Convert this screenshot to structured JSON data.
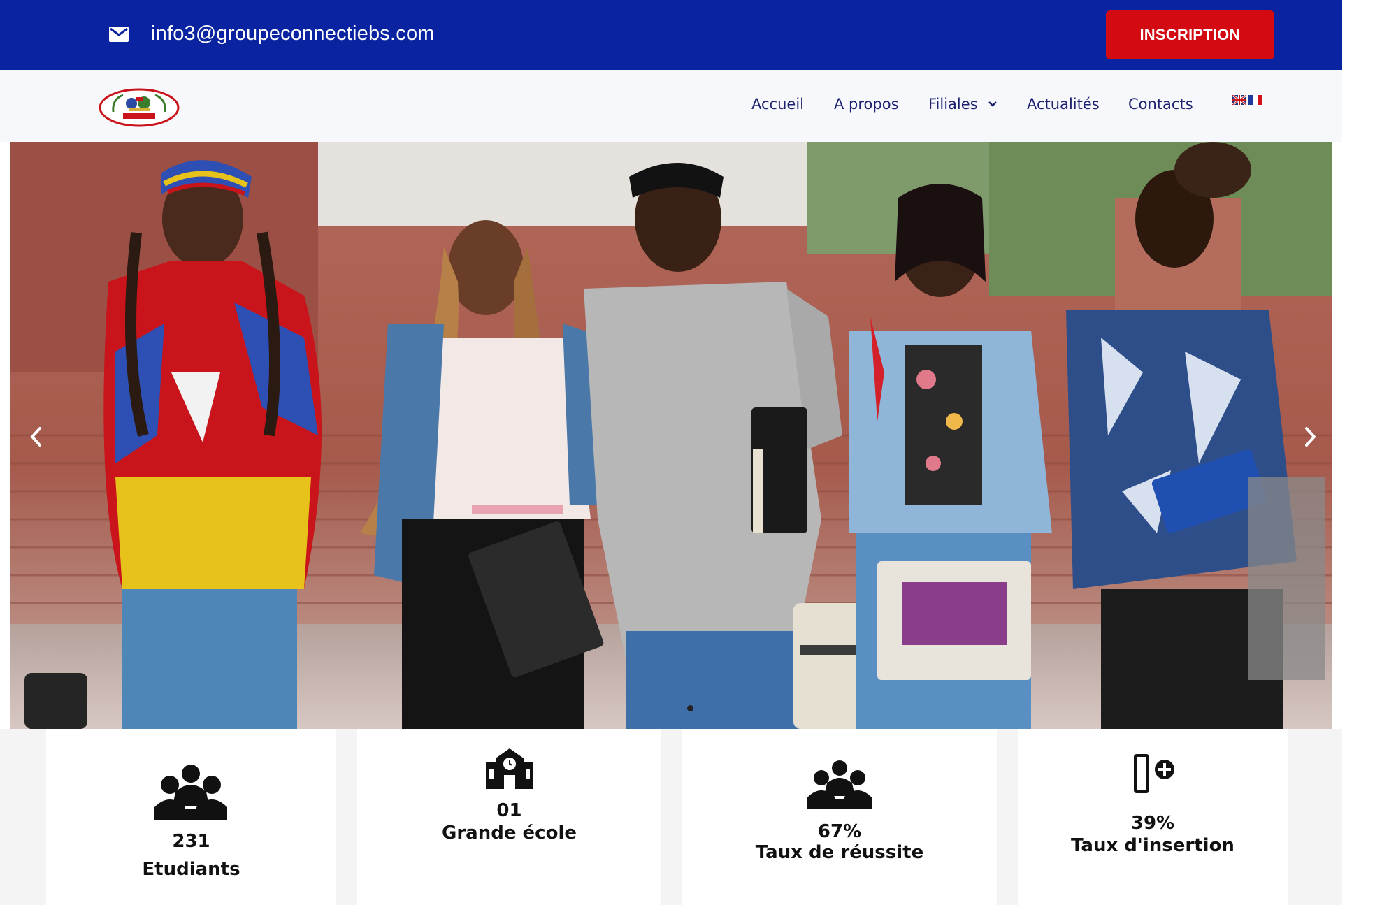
{
  "topbar": {
    "email": "info3@groupeconnectiebs.com",
    "email_icon": "mail-icon",
    "cta_label": "INSCRIPTION",
    "background": "#0a23a0",
    "cta_color": "#d40a12"
  },
  "nav": {
    "logo": "groupe-connect-logo",
    "items": [
      {
        "label": "Accueil"
      },
      {
        "label": "A propos"
      },
      {
        "label": "Filiales",
        "icon": "chevron-down-icon"
      },
      {
        "label": "Actualités"
      },
      {
        "label": "Contacts"
      }
    ],
    "languages": [
      "english-flag-icon",
      "french-flag-icon"
    ],
    "text_color": "#1d2270"
  },
  "hero": {
    "image": "five smiling students walking on campus",
    "prev_icon": "chevron-left-icon",
    "next_icon": "chevron-right-icon",
    "slide_count": 1,
    "active_slide": 1
  },
  "stats": [
    {
      "value": "231",
      "label": "Etudiants",
      "icon": "students-group-icon"
    },
    {
      "value": "01",
      "label": "Grande école",
      "icon": "school-building-icon"
    },
    {
      "value": "67%",
      "label": "Taux de réussite",
      "icon": "graduates-group-icon"
    },
    {
      "value": "39%",
      "label": "Taux d'insertion",
      "icon": "door-plus-icon"
    }
  ]
}
